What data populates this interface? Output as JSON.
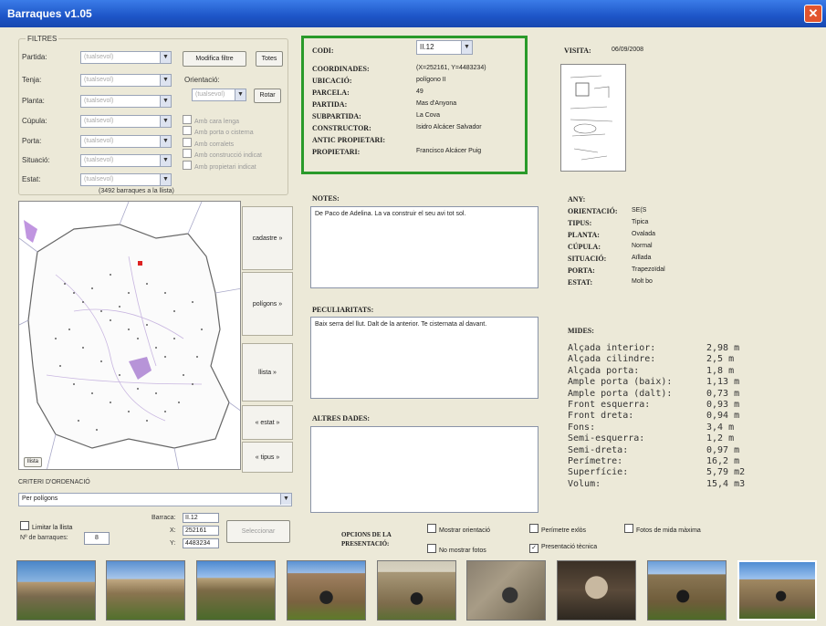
{
  "window": {
    "title": "Barraques v1.05"
  },
  "filters": {
    "group_label": "FILTRES",
    "rows": [
      {
        "label": "Partida:",
        "value": "(tualsevol)"
      },
      {
        "label": "Tenja:",
        "value": "(tualsevol)"
      },
      {
        "label": "Planta:",
        "value": "(tualsevol)"
      },
      {
        "label": "Cúpula:",
        "value": "(tualsevol)"
      },
      {
        "label": "Porta:",
        "value": "(tualsevol)"
      },
      {
        "label": "Situació:",
        "value": "(tualsevol)"
      },
      {
        "label": "Estat:",
        "value": "(tualsevol)"
      }
    ],
    "modify_button": "Modifica filtre",
    "all_button": "Totes",
    "orientation_label": "Orientació:",
    "orientation_value": "(tualsevol)",
    "rotate_button": "Rotar",
    "checks": [
      "Amb cara lenga",
      "Amb porta o cisterna",
      "Amb corralets",
      "Amb construcció indicat",
      "Amb propietari indicat"
    ],
    "count_text": "(3492 barraques a la llista)"
  },
  "map_buttons": [
    "cadastre »",
    "polígons »",
    "llista »",
    "« estat »",
    "« tipus »"
  ],
  "small_button": "llista",
  "sort": {
    "label": "CRITERI D'ORDENACIÓ",
    "value": "Per polígons"
  },
  "limit": {
    "check_label": "Limitar la llista",
    "count_label": "Nº de barraques:",
    "count_value": "8",
    "barraca_label": "Barraca:",
    "barraca_value": "II.12",
    "x_label": "X:",
    "x_value": "252161",
    "y_label": "Y:",
    "y_value": "4483234",
    "locate_button": "Seleccionar"
  },
  "record": {
    "code_label": "CODI:",
    "code_value": "II.12",
    "fields": [
      {
        "label": "COORDINADES:",
        "value": "(X=252161, Y=4483234)"
      },
      {
        "label": "UBICACIÓ:",
        "value": "polígono II"
      },
      {
        "label": "PARCELA:",
        "value": "49"
      },
      {
        "label": "PARTIDA:",
        "value": "Mas d'Anyona"
      },
      {
        "label": "SUBPARTIDA:",
        "value": "La Cova"
      },
      {
        "label": "CONSTRUCTOR:",
        "value": "Isidro Alcácer Salvador"
      },
      {
        "label": "ANTIC PROPIETARI:",
        "value": ""
      },
      {
        "label": "PROPIETARI:",
        "value": "Francisco Alcácer Puig"
      }
    ]
  },
  "visit": {
    "label": "VISITA:",
    "date": "06/09/2008"
  },
  "notes": {
    "label": "NOTES:",
    "text": "De Paco de Adelina. La va construir el seu avi tot sol."
  },
  "peculiar": {
    "label": "PECULIARITATS:",
    "text": "Baix serra del llut. Dalt de la anterior. Te cisternata al davant."
  },
  "other": {
    "label": "ALTRES DADES:",
    "text": ""
  },
  "attributes": [
    {
      "label": "ANY:",
      "value": ""
    },
    {
      "label": "ORIENTACIÓ:",
      "value": "SE(S"
    },
    {
      "label": "TIPUS:",
      "value": "Tipica"
    },
    {
      "label": "PLANTA:",
      "value": "Ovalada"
    },
    {
      "label": "CÚPULA:",
      "value": "Normal"
    },
    {
      "label": "SITUACIÓ:",
      "value": "Aïllada"
    },
    {
      "label": "PORTA:",
      "value": "Trapezoïdal"
    },
    {
      "label": "ESTAT:",
      "value": "Molt bo"
    }
  ],
  "measures": {
    "label": "MIDES:",
    "rows": [
      {
        "name": "Alçada interior:",
        "value": "2,98 m"
      },
      {
        "name": "Alçada cilindre:",
        "value": "2,5 m"
      },
      {
        "name": "Alçada porta:",
        "value": "1,8 m"
      },
      {
        "name": "Ample porta (baix):",
        "value": "1,13 m"
      },
      {
        "name": "Ample porta (dalt):",
        "value": "0,73 m"
      },
      {
        "name": "Front esquerra:",
        "value": "0,93 m"
      },
      {
        "name": "Front dreta:",
        "value": "0,94 m"
      },
      {
        "name": "Fons:",
        "value": "3,4 m"
      },
      {
        "name": "Semi-esquerra:",
        "value": "1,2 m"
      },
      {
        "name": "Semi-dreta:",
        "value": "0,97 m"
      },
      {
        "name": "Perímetre:",
        "value": "16,2 m"
      },
      {
        "name": "Superfície:",
        "value": "5,79 m2"
      },
      {
        "name": "Volum:",
        "value": "15,4 m3"
      }
    ]
  },
  "presentation": {
    "label_line1": "OPCIONS DE LA",
    "label_line2": "PRESENTACIÓ:",
    "opt_orientation": "Mostrar orientació",
    "opt_perimeter": "Perímetre exlòs",
    "opt_photos_max": "Fotos de mida màxima",
    "opt_no_photos": "No mostrar fotos",
    "opt_technical": "Presentació tècnica"
  },
  "colors": {
    "highlight_border": "#2a9a2a",
    "title_bar": "#1d55c7"
  }
}
